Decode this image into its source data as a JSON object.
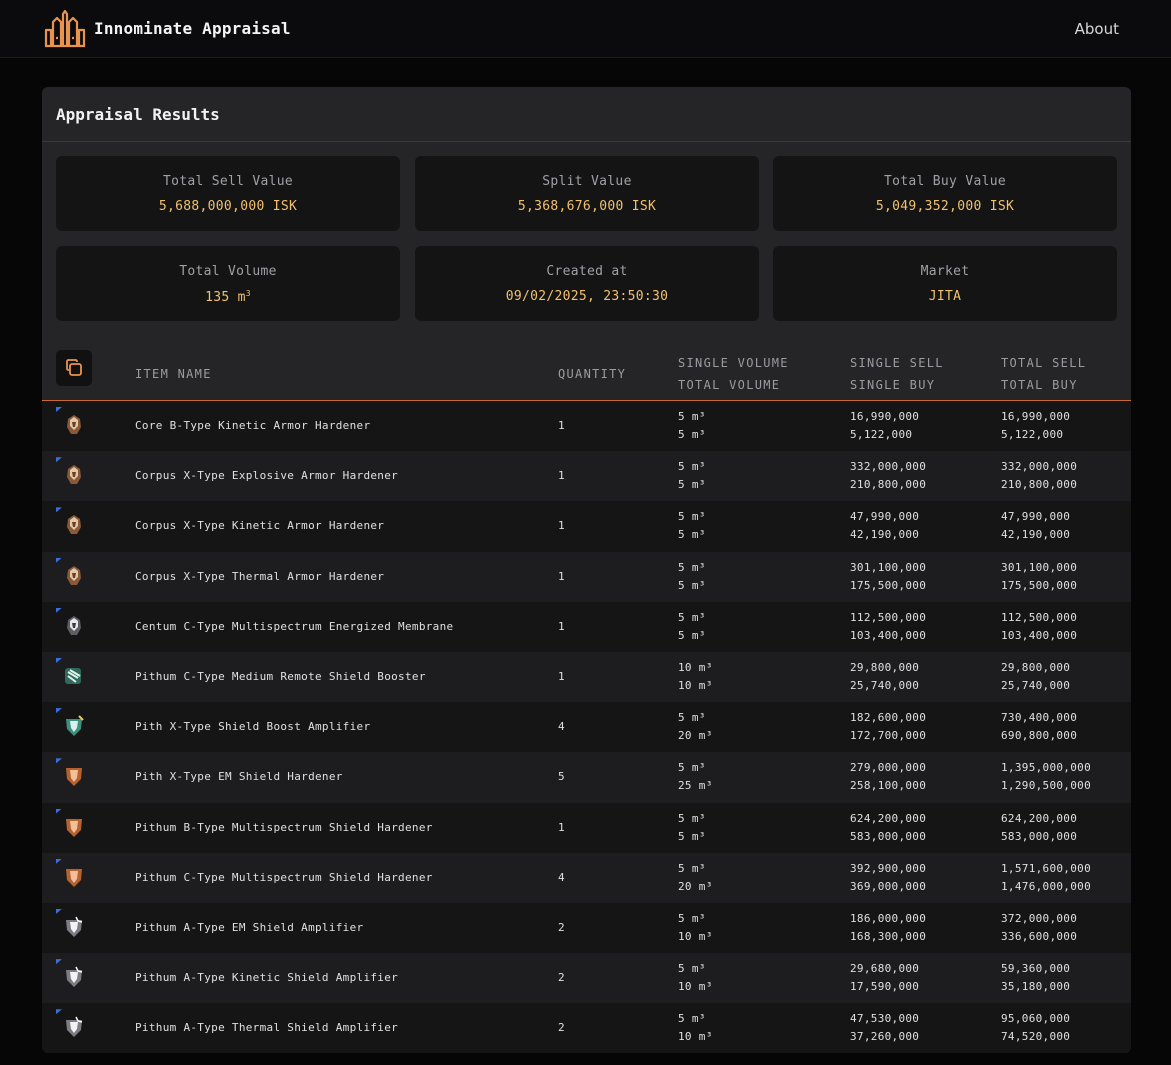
{
  "app": {
    "title": "Innominate Appraisal",
    "about_label": "About"
  },
  "panel": {
    "title": "Appraisal Results"
  },
  "summary": {
    "total_sell": {
      "label": "Total Sell Value",
      "value": "5,688,000,000 ISK"
    },
    "split": {
      "label": "Split Value",
      "value": "5,368,676,000 ISK"
    },
    "total_buy": {
      "label": "Total Buy Value",
      "value": "5,049,352,000 ISK"
    },
    "total_volume": {
      "label": "Total Volume",
      "value": "135 m",
      "unit_exp": "3"
    },
    "created_at": {
      "label": "Created at",
      "value": "09/02/2025, 23:50:30"
    },
    "market": {
      "label": "Market",
      "value": "JITA"
    }
  },
  "columns": {
    "item_name": "ITEM NAME",
    "quantity": "QUANTITY",
    "single_volume": "SINGLE VOLUME",
    "total_volume": "TOTAL VOLUME",
    "single_sell": "SINGLE SELL",
    "single_buy": "SINGLE BUY",
    "total_sell": "TOTAL SELL",
    "total_buy": "TOTAL BUY"
  },
  "items": [
    {
      "name": "Core B-Type Kinetic Armor Hardener",
      "icon": "armor-hardener-icon",
      "qty": "1",
      "single_volume": "5 m³",
      "total_volume": "5 m³",
      "single_sell": "16,990,000",
      "single_buy": "5,122,000",
      "total_sell": "16,990,000",
      "total_buy": "5,122,000"
    },
    {
      "name": "Corpus X-Type Explosive Armor Hardener",
      "icon": "armor-hardener-icon",
      "qty": "1",
      "single_volume": "5 m³",
      "total_volume": "5 m³",
      "single_sell": "332,000,000",
      "single_buy": "210,800,000",
      "total_sell": "332,000,000",
      "total_buy": "210,800,000"
    },
    {
      "name": "Corpus X-Type Kinetic Armor Hardener",
      "icon": "armor-hardener-icon",
      "qty": "1",
      "single_volume": "5 m³",
      "total_volume": "5 m³",
      "single_sell": "47,990,000",
      "single_buy": "42,190,000",
      "total_sell": "47,990,000",
      "total_buy": "42,190,000"
    },
    {
      "name": "Corpus X-Type Thermal Armor Hardener",
      "icon": "armor-hardener-icon",
      "qty": "1",
      "single_volume": "5 m³",
      "total_volume": "5 m³",
      "single_sell": "301,100,000",
      "single_buy": "175,500,000",
      "total_sell": "301,100,000",
      "total_buy": "175,500,000"
    },
    {
      "name": "Centum C-Type Multispectrum Energized Membrane",
      "icon": "energized-membrane-icon",
      "qty": "1",
      "single_volume": "5 m³",
      "total_volume": "5 m³",
      "single_sell": "112,500,000",
      "single_buy": "103,400,000",
      "total_sell": "112,500,000",
      "total_buy": "103,400,000"
    },
    {
      "name": "Pithum C-Type Medium Remote Shield Booster",
      "icon": "remote-shield-booster-icon",
      "qty": "1",
      "single_volume": "10 m³",
      "total_volume": "10 m³",
      "single_sell": "29,800,000",
      "single_buy": "25,740,000",
      "total_sell": "29,800,000",
      "total_buy": "25,740,000"
    },
    {
      "name": "Pith X-Type Shield Boost Amplifier",
      "icon": "shield-boost-amplifier-icon",
      "qty": "4",
      "single_volume": "5 m³",
      "total_volume": "20 m³",
      "single_sell": "182,600,000",
      "single_buy": "172,700,000",
      "total_sell": "730,400,000",
      "total_buy": "690,800,000"
    },
    {
      "name": "Pith X-Type EM Shield Hardener",
      "icon": "shield-hardener-icon",
      "qty": "5",
      "single_volume": "5 m³",
      "total_volume": "25 m³",
      "single_sell": "279,000,000",
      "single_buy": "258,100,000",
      "total_sell": "1,395,000,000",
      "total_buy": "1,290,500,000"
    },
    {
      "name": "Pithum B-Type Multispectrum Shield Hardener",
      "icon": "shield-hardener-icon",
      "qty": "1",
      "single_volume": "5 m³",
      "total_volume": "5 m³",
      "single_sell": "624,200,000",
      "single_buy": "583,000,000",
      "total_sell": "624,200,000",
      "total_buy": "583,000,000"
    },
    {
      "name": "Pithum C-Type Multispectrum Shield Hardener",
      "icon": "shield-hardener-icon",
      "qty": "4",
      "single_volume": "5 m³",
      "total_volume": "20 m³",
      "single_sell": "392,900,000",
      "single_buy": "369,000,000",
      "total_sell": "1,571,600,000",
      "total_buy": "1,476,000,000"
    },
    {
      "name": "Pithum A-Type EM Shield Amplifier",
      "icon": "shield-amplifier-icon",
      "qty": "2",
      "single_volume": "5 m³",
      "total_volume": "10 m³",
      "single_sell": "186,000,000",
      "single_buy": "168,300,000",
      "total_sell": "372,000,000",
      "total_buy": "336,600,000"
    },
    {
      "name": "Pithum A-Type Kinetic Shield Amplifier",
      "icon": "shield-amplifier-icon",
      "qty": "2",
      "single_volume": "5 m³",
      "total_volume": "10 m³",
      "single_sell": "29,680,000",
      "single_buy": "17,590,000",
      "total_sell": "59,360,000",
      "total_buy": "35,180,000"
    },
    {
      "name": "Pithum A-Type Thermal Shield Amplifier",
      "icon": "shield-amplifier-icon",
      "qty": "2",
      "single_volume": "5 m³",
      "total_volume": "10 m³",
      "single_sell": "47,530,000",
      "single_buy": "37,260,000",
      "total_sell": "95,060,000",
      "total_buy": "74,520,000"
    }
  ],
  "colors": {
    "accent": "#f2c06f",
    "header_rule": "#c96a33",
    "logo": "#e8944f",
    "panel": "#252527"
  }
}
